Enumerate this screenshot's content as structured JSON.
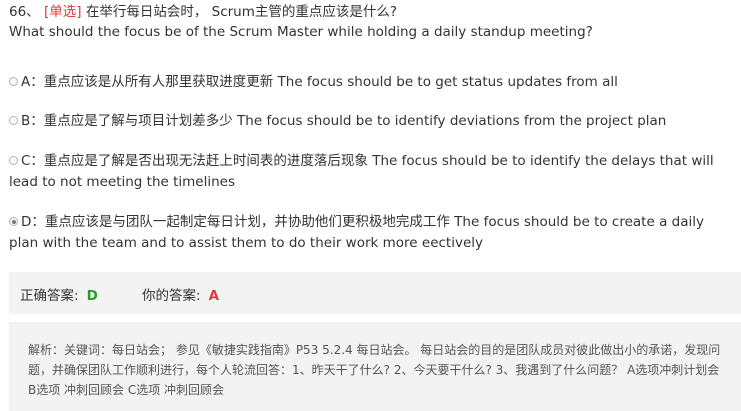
{
  "question": {
    "number": "66、",
    "tag": "[单选]",
    "text_cn": "在举行每日站会时， Scrum主管的重点应该是什么?",
    "text_en": "What should the focus be of the Scrum Master while holding a daily standup meeting?"
  },
  "options": [
    {
      "text": "A：重点应该是从所有人那里获取进度更新 The focus should be to get status updates from all",
      "checked": false
    },
    {
      "text": "B：重点应是了解与项目计划差多少 The focus should be to identify deviations from the project plan",
      "checked": false
    },
    {
      "text": "C：重点应是了解是否出现无法赶上时间表的进度落后现象 The focus should be to identify the delays that will lead to not meeting the timelines",
      "checked": false
    },
    {
      "text": "D：重点应该是与团队一起制定每日计划，并协助他们更积极地完成工作 The focus should be to create a daily plan with the team and to assist them to do their work more eectively",
      "checked": true
    }
  ],
  "answer": {
    "correct_label": "正确答案:",
    "correct_value": "D",
    "yours_label": "你的答案:",
    "yours_value": "A",
    "correct_color": "#22a022",
    "wrong_color": "#e0393e"
  },
  "explanation": "解析：关键词：每日站会； 参见《敏捷实践指南》P53 5.2.4 每日站会。 每日站会的目的是团队成员对彼此做出小的承诺，发现问题，并确保团队工作顺利进行，每个人轮流回答：1、昨天干了什么? 2、今天要干什么? 3、我遇到了什么问题？ A选项冲刺计划会 B选项 冲刺回顾会 C选项 冲刺回顾会"
}
